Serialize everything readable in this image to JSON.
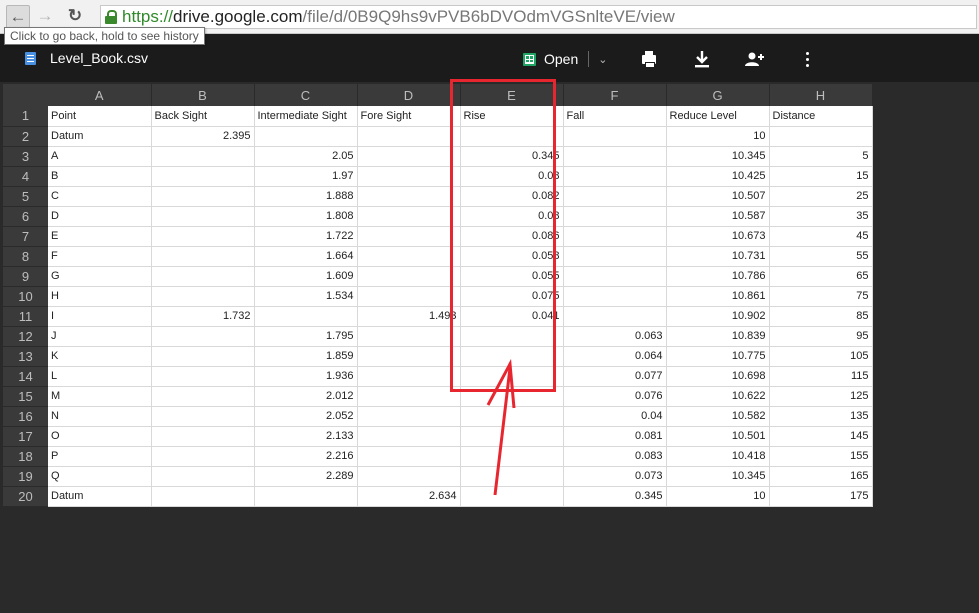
{
  "browser": {
    "url_scheme": "https://",
    "url_host": "drive.google.com",
    "url_path": "/file/d/0B9Q9hs9vPVB6bDVOdmVGSnlteVE/view",
    "tooltip": "Click to go back, hold to see history"
  },
  "toolbar": {
    "file_name": "Level_Book.csv",
    "open_label": "Open"
  },
  "sheet": {
    "columns": [
      "A",
      "B",
      "C",
      "D",
      "E",
      "F",
      "G",
      "H"
    ],
    "rows": [
      {
        "n": "1",
        "cells": [
          "Point",
          "Back Sight",
          "Intermediate Sight",
          "Fore Sight",
          "Rise",
          "Fall",
          "Reduce Level",
          "Distance"
        ]
      },
      {
        "n": "2",
        "cells": [
          "Datum",
          "2.395",
          "",
          "",
          "",
          "",
          "10",
          ""
        ]
      },
      {
        "n": "3",
        "cells": [
          "A",
          "",
          "2.05",
          "",
          "0.345",
          "",
          "10.345",
          "5"
        ]
      },
      {
        "n": "4",
        "cells": [
          "B",
          "",
          "1.97",
          "",
          "0.08",
          "",
          "10.425",
          "15"
        ]
      },
      {
        "n": "5",
        "cells": [
          "C",
          "",
          "1.888",
          "",
          "0.082",
          "",
          "10.507",
          "25"
        ]
      },
      {
        "n": "6",
        "cells": [
          "D",
          "",
          "1.808",
          "",
          "0.08",
          "",
          "10.587",
          "35"
        ]
      },
      {
        "n": "7",
        "cells": [
          "E",
          "",
          "1.722",
          "",
          "0.086",
          "",
          "10.673",
          "45"
        ]
      },
      {
        "n": "8",
        "cells": [
          "F",
          "",
          "1.664",
          "",
          "0.058",
          "",
          "10.731",
          "55"
        ]
      },
      {
        "n": "9",
        "cells": [
          "G",
          "",
          "1.609",
          "",
          "0.055",
          "",
          "10.786",
          "65"
        ]
      },
      {
        "n": "10",
        "cells": [
          "H",
          "",
          "1.534",
          "",
          "0.075",
          "",
          "10.861",
          "75"
        ]
      },
      {
        "n": "11",
        "cells": [
          "I",
          "1.732",
          "",
          "1.493",
          "0.041",
          "",
          "10.902",
          "85"
        ]
      },
      {
        "n": "12",
        "cells": [
          "J",
          "",
          "1.795",
          "",
          "",
          "0.063",
          "10.839",
          "95"
        ]
      },
      {
        "n": "13",
        "cells": [
          "K",
          "",
          "1.859",
          "",
          "",
          "0.064",
          "10.775",
          "105"
        ]
      },
      {
        "n": "14",
        "cells": [
          "L",
          "",
          "1.936",
          "",
          "",
          "0.077",
          "10.698",
          "115"
        ]
      },
      {
        "n": "15",
        "cells": [
          "M",
          "",
          "2.012",
          "",
          "",
          "0.076",
          "10.622",
          "125"
        ]
      },
      {
        "n": "16",
        "cells": [
          "N",
          "",
          "2.052",
          "",
          "",
          "0.04",
          "10.582",
          "135"
        ]
      },
      {
        "n": "17",
        "cells": [
          "O",
          "",
          "2.133",
          "",
          "",
          "0.081",
          "10.501",
          "145"
        ]
      },
      {
        "n": "18",
        "cells": [
          "P",
          "",
          "2.216",
          "",
          "",
          "0.083",
          "10.418",
          "155"
        ]
      },
      {
        "n": "19",
        "cells": [
          "Q",
          "",
          "2.289",
          "",
          "",
          "0.073",
          "10.345",
          "165"
        ]
      },
      {
        "n": "20",
        "cells": [
          "Datum",
          "",
          "",
          "2.634",
          "",
          "0.345",
          "10",
          "175"
        ]
      }
    ]
  },
  "colors": {
    "highlight": "#e8262f",
    "toolbar_bg": "#1b1b1b",
    "sheets_green": "#1fa463"
  }
}
